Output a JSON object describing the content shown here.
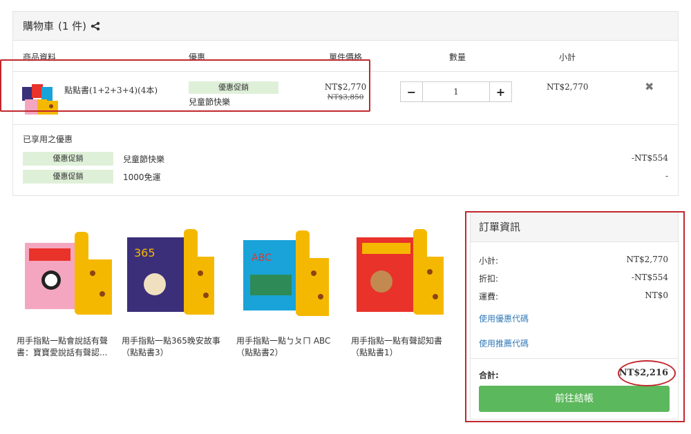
{
  "cart": {
    "title": "購物車",
    "count": "(1 件)",
    "columns": {
      "product": "商品資料",
      "promo": "優惠",
      "unit_price": "單件價格",
      "quantity": "數量",
      "subtotal": "小計"
    },
    "item": {
      "name": "點點書(1+2+3+4)(4本)",
      "promo_tag": "優惠促銷",
      "promo_name": "兒童節快樂",
      "price": "NT$2,770",
      "original_price": "NT$3,850",
      "quantity": "1",
      "subtotal": "NT$2,770",
      "minus": "−",
      "plus": "+",
      "remove": "✖"
    }
  },
  "applied": {
    "title": "已享用之優惠",
    "lines": [
      {
        "tag": "優惠促銷",
        "name": "兒童節快樂",
        "amount": "-NT$554"
      },
      {
        "tag": "優惠促銷",
        "name": "1000免運",
        "amount": "-"
      }
    ]
  },
  "recommendations": [
    {
      "title": "用手指點一點會說話有聲書：寶寶愛說話有聲認...",
      "cover_color": "#f4a6c0"
    },
    {
      "title": "用手指點一點365晚安故事（點點書3）",
      "cover_color": "#3b2f7a"
    },
    {
      "title": "用手指點一點ㄅㄆㄇ ABC（點點書2）",
      "cover_color": "#1aa3d9"
    },
    {
      "title": "用手指點一點有聲認知書（點點書1）",
      "cover_color": "#e8322a"
    }
  ],
  "order": {
    "title": "訂單資訊",
    "subtotal_label": "小計:",
    "subtotal_value": "NT$2,770",
    "discount_label": "折扣:",
    "discount_value": "-NT$554",
    "shipping_label": "運費:",
    "shipping_value": "NT$0",
    "coupon_link": "使用優惠代碼",
    "referral_link": "使用推薦代碼",
    "total_label": "合計:",
    "total_value": "NT$2,216",
    "checkout_label": "前往結帳"
  },
  "colors": {
    "accent_green": "#5cb85c",
    "tag_green": "#dff0d8",
    "highlight_red": "#c0272d",
    "link_blue": "#337ab7"
  }
}
